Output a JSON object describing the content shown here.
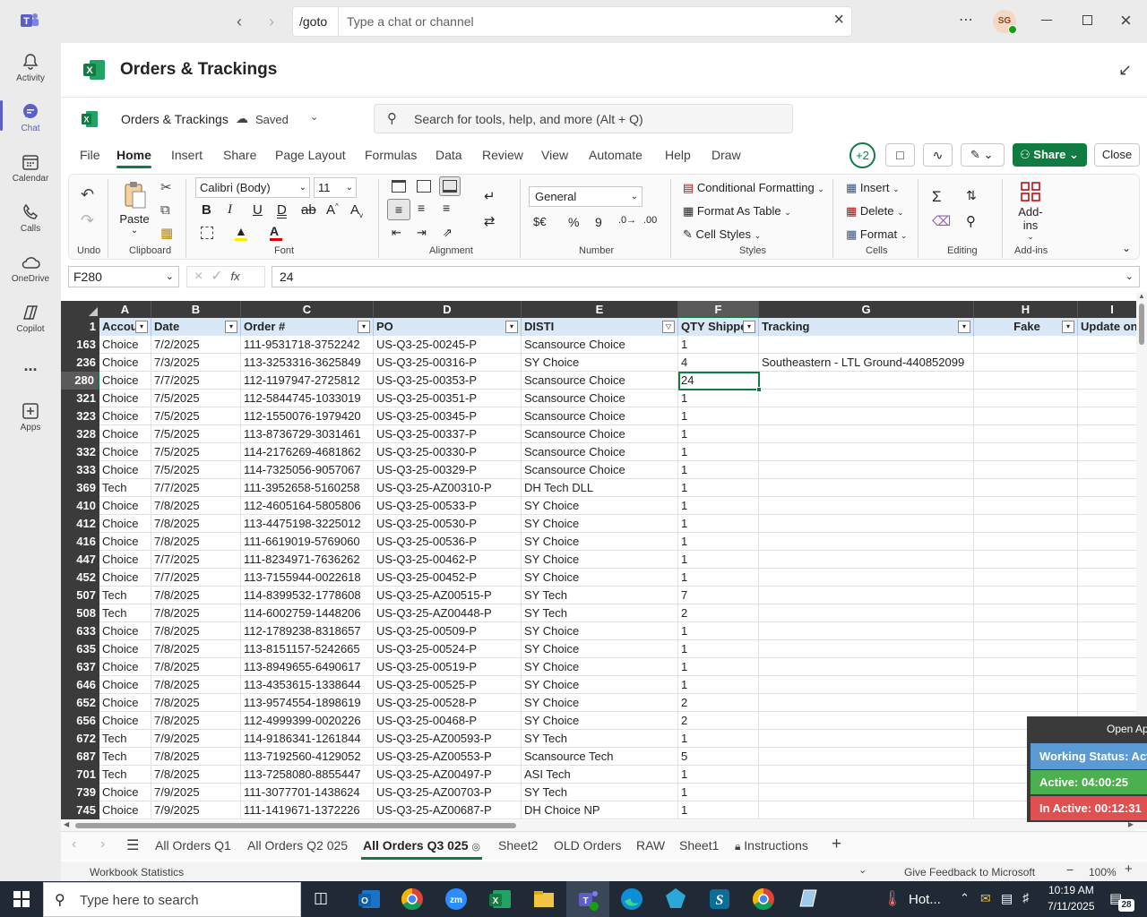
{
  "teams": {
    "goto": "/goto",
    "search_placeholder": "Type a chat or channel",
    "avatar": "SG",
    "rail": [
      {
        "label": "Activity"
      },
      {
        "label": "Chat"
      },
      {
        "label": "Calendar"
      },
      {
        "label": "Calls"
      },
      {
        "label": "OneDrive"
      },
      {
        "label": "Copilot"
      },
      {
        "label": "..."
      },
      {
        "label": "Apps"
      }
    ]
  },
  "doc": {
    "title": "Orders & Trackings",
    "file_name": "Orders & Trackings",
    "saved": "Saved",
    "search_placeholder": "Search for tools, help, and more (Alt + Q)"
  },
  "menu": [
    "File",
    "Home",
    "Insert",
    "Share",
    "Page Layout",
    "Formulas",
    "Data",
    "Review",
    "View",
    "Automate",
    "Help",
    "Draw"
  ],
  "collab_count": "+2",
  "share_label": "Share",
  "close_label": "Close",
  "ribbon": {
    "undo": "Undo",
    "paste": "Paste",
    "clipboard": "Clipboard",
    "font_name": "Calibri (Body)",
    "font_size": "11",
    "font": "Font",
    "alignment": "Alignment",
    "number_format": "General",
    "number": "Number",
    "conditional_formatting": "Conditional Formatting",
    "format_as_table": "Format As Table",
    "cell_styles": "Cell Styles",
    "styles": "Styles",
    "insert": "Insert",
    "delete": "Delete",
    "format": "Format",
    "cells": "Cells",
    "editing": "Editing",
    "addins": "Add-ins",
    "addins_group": "Add-ins"
  },
  "formula_bar": {
    "name_box": "F280",
    "fx": "fx",
    "value": "24"
  },
  "columns": [
    "A",
    "B",
    "C",
    "D",
    "E",
    "F",
    "G",
    "H",
    "I"
  ],
  "header_row": {
    "num": "1",
    "cells": [
      "Accou",
      "Date",
      "Order #",
      "PO",
      "DISTI",
      "QTY Shippe",
      "Tracking",
      "Fake",
      "Update on"
    ]
  },
  "rows": [
    {
      "n": "163",
      "a": "Choice",
      "b": "7/2/2025",
      "c": "111-9531718-3752242",
      "d": "US-Q3-25-00245-P",
      "e": "Scansource Choice",
      "f": "1",
      "g": ""
    },
    {
      "n": "236",
      "a": "Choice",
      "b": "7/3/2025",
      "c": "113-3253316-3625849",
      "d": "US-Q3-25-00316-P",
      "e": "SY Choice",
      "f": "4",
      "g": "Southeastern - LTL Ground-440852099"
    },
    {
      "n": "280",
      "a": "Choice",
      "b": "7/7/2025",
      "c": "112-1197947-2725812",
      "d": "US-Q3-25-00353-P",
      "e": "Scansource Choice",
      "f": "24",
      "g": ""
    },
    {
      "n": "321",
      "a": "Choice",
      "b": "7/5/2025",
      "c": "112-5844745-1033019",
      "d": "US-Q3-25-00351-P",
      "e": "Scansource Choice",
      "f": "1",
      "g": ""
    },
    {
      "n": "323",
      "a": "Choice",
      "b": "7/5/2025",
      "c": "112-1550076-1979420",
      "d": "US-Q3-25-00345-P",
      "e": "Scansource Choice",
      "f": "1",
      "g": ""
    },
    {
      "n": "328",
      "a": "Choice",
      "b": "7/5/2025",
      "c": "113-8736729-3031461",
      "d": "US-Q3-25-00337-P",
      "e": "Scansource Choice",
      "f": "1",
      "g": ""
    },
    {
      "n": "332",
      "a": "Choice",
      "b": "7/5/2025",
      "c": "114-2176269-4681862",
      "d": "US-Q3-25-00330-P",
      "e": "Scansource Choice",
      "f": "1",
      "g": ""
    },
    {
      "n": "333",
      "a": "Choice",
      "b": "7/5/2025",
      "c": "114-7325056-9057067",
      "d": "US-Q3-25-00329-P",
      "e": "Scansource Choice",
      "f": "1",
      "g": ""
    },
    {
      "n": "369",
      "a": "Tech",
      "b": "7/7/2025",
      "c": "111-3952658-5160258",
      "d": "US-Q3-25-AZ00310-P",
      "e": "DH Tech DLL",
      "f": "1",
      "g": ""
    },
    {
      "n": "410",
      "a": "Choice",
      "b": "7/8/2025",
      "c": "112-4605164-5805806",
      "d": "US-Q3-25-00533-P",
      "e": "SY Choice",
      "f": "1",
      "g": ""
    },
    {
      "n": "412",
      "a": "Choice",
      "b": "7/8/2025",
      "c": "113-4475198-3225012",
      "d": "US-Q3-25-00530-P",
      "e": "SY Choice",
      "f": "1",
      "g": ""
    },
    {
      "n": "416",
      "a": "Choice",
      "b": "7/8/2025",
      "c": "111-6619019-5769060",
      "d": "US-Q3-25-00536-P",
      "e": "SY Choice",
      "f": "1",
      "g": ""
    },
    {
      "n": "447",
      "a": "Choice",
      "b": "7/7/2025",
      "c": "111-8234971-7636262",
      "d": "US-Q3-25-00462-P",
      "e": "SY Choice",
      "f": "1",
      "g": ""
    },
    {
      "n": "452",
      "a": "Choice",
      "b": "7/7/2025",
      "c": "113-7155944-0022618",
      "d": "US-Q3-25-00452-P",
      "e": "SY Choice",
      "f": "1",
      "g": ""
    },
    {
      "n": "507",
      "a": "Tech",
      "b": "7/8/2025",
      "c": "114-8399532-1778608",
      "d": "US-Q3-25-AZ00515-P",
      "e": "SY Tech",
      "f": "7",
      "g": ""
    },
    {
      "n": "508",
      "a": "Tech",
      "b": "7/8/2025",
      "c": "114-6002759-1448206",
      "d": "US-Q3-25-AZ00448-P",
      "e": "SY Tech",
      "f": "2",
      "g": ""
    },
    {
      "n": "633",
      "a": "Choice",
      "b": "7/8/2025",
      "c": "112-1789238-8318657",
      "d": "US-Q3-25-00509-P",
      "e": "SY Choice",
      "f": "1",
      "g": ""
    },
    {
      "n": "635",
      "a": "Choice",
      "b": "7/8/2025",
      "c": "113-8151157-5242665",
      "d": "US-Q3-25-00524-P",
      "e": "SY Choice",
      "f": "1",
      "g": ""
    },
    {
      "n": "637",
      "a": "Choice",
      "b": "7/8/2025",
      "c": "113-8949655-6490617",
      "d": "US-Q3-25-00519-P",
      "e": "SY Choice",
      "f": "1",
      "g": ""
    },
    {
      "n": "646",
      "a": "Choice",
      "b": "7/8/2025",
      "c": "113-4353615-1338644",
      "d": "US-Q3-25-00525-P",
      "e": "SY Choice",
      "f": "1",
      "g": ""
    },
    {
      "n": "652",
      "a": "Choice",
      "b": "7/8/2025",
      "c": "113-9574554-1898619",
      "d": "US-Q3-25-00528-P",
      "e": "SY Choice",
      "f": "2",
      "g": ""
    },
    {
      "n": "656",
      "a": "Choice",
      "b": "7/8/2025",
      "c": "112-4999399-0020226",
      "d": "US-Q3-25-00468-P",
      "e": "SY Choice",
      "f": "2",
      "g": ""
    },
    {
      "n": "672",
      "a": "Tech",
      "b": "7/9/2025",
      "c": "114-9186341-1261844",
      "d": "US-Q3-25-AZ00593-P",
      "e": "SY Tech",
      "f": "1",
      "g": ""
    },
    {
      "n": "687",
      "a": "Tech",
      "b": "7/8/2025",
      "c": "113-7192560-4129052",
      "d": "US-Q3-25-AZ00553-P",
      "e": "Scansource Tech",
      "f": "5",
      "g": ""
    },
    {
      "n": "701",
      "a": "Tech",
      "b": "7/8/2025",
      "c": "113-7258080-8855447",
      "d": "US-Q3-25-AZ00497-P",
      "e": "ASI Tech",
      "f": "1",
      "g": ""
    },
    {
      "n": "739",
      "a": "Choice",
      "b": "7/9/2025",
      "c": "111-3077701-1438624",
      "d": "US-Q3-25-AZ00703-P",
      "e": "SY Tech",
      "f": "1",
      "g": ""
    },
    {
      "n": "745",
      "a": "Choice",
      "b": "7/9/2025",
      "c": "111-1419671-1372226",
      "d": "US-Q3-25-AZ00687-P",
      "e": "DH Choice NP",
      "f": "1",
      "g": ""
    }
  ],
  "popup": {
    "open": "Open Ap",
    "working": "Working Status: Activ",
    "active": "Active: 04:00:25",
    "inactive": "In Active: 00:12:31"
  },
  "sheets": [
    "All Orders Q1",
    "All Orders Q2 025",
    "All Orders Q3 025",
    "Sheet2",
    "OLD Orders",
    "RAW",
    "Sheet1",
    "Instructions"
  ],
  "active_sheet": "All Orders Q3 025",
  "status": {
    "left": "Workbook Statistics",
    "feedback": "Give Feedback to Microsoft",
    "zoom": "100%"
  },
  "taskbar": {
    "search": "Type here to search",
    "weather": "Hot...",
    "time": "10:19 AM",
    "date": "7/11/2025",
    "notif": "28"
  },
  "colors": {
    "excel_green": "#107c41",
    "teams_purple": "#5b5fc7",
    "header_fill": "#d9e8f6",
    "dark_header": "#3b3b3b"
  }
}
